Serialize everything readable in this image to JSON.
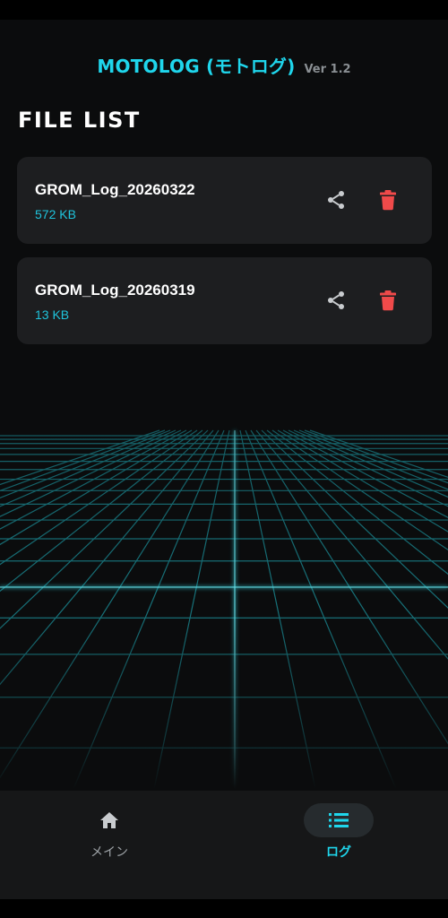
{
  "app": {
    "title": "MOTOLOG (モトログ)",
    "version": "Ver 1.2"
  },
  "section_title": "FILE LIST",
  "files": [
    {
      "name": "GROM_Log_20260322",
      "size": "572 KB"
    },
    {
      "name": "GROM_Log_20260319",
      "size": "13 KB"
    }
  ],
  "bottom_nav": {
    "items": [
      {
        "label": "メイン",
        "icon": "home-icon",
        "selected": false
      },
      {
        "label": "ログ",
        "icon": "list-icon",
        "selected": true
      }
    ]
  },
  "colors": {
    "accent": "#1fd6ec",
    "delete": "#f04a4a",
    "card": "#1d1e20",
    "background": "#0b0c0d"
  }
}
